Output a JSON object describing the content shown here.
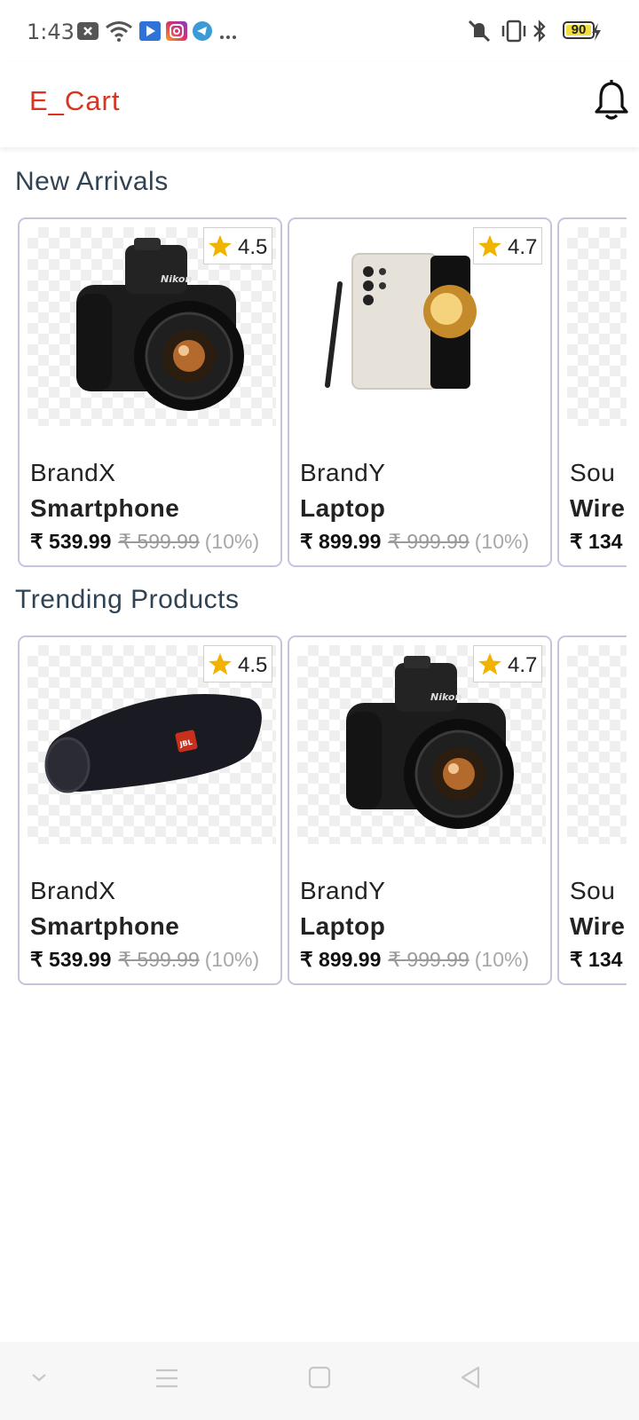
{
  "status_bar": {
    "time": "1:43",
    "battery_level": "90",
    "icons": [
      "close-box-icon",
      "wifi-icon",
      "play-store-icon",
      "instagram-icon",
      "telegram-icon",
      "more-icon",
      "silent-icon",
      "vibrate-icon",
      "bluetooth-icon",
      "battery-icon",
      "charging-icon"
    ]
  },
  "app_bar": {
    "title": "E_Cart",
    "notification_icon": "bell-icon"
  },
  "sections": [
    {
      "title": "New Arrivals",
      "products": [
        {
          "brand": "BrandX",
          "name": "Smartphone",
          "price": "₹ 539.99",
          "mrp": "₹ 599.99",
          "discount": "(10%)",
          "rating": "4.5",
          "image": "camera"
        },
        {
          "brand": "BrandY",
          "name": "Laptop",
          "price": "₹ 899.99",
          "mrp": "₹ 999.99",
          "discount": "(10%)",
          "rating": "4.7",
          "image": "phone"
        },
        {
          "brand": "Sou",
          "name": "Wire",
          "price": "₹ 134",
          "image": "blank"
        }
      ]
    },
    {
      "title": "Trending Products",
      "products": [
        {
          "brand": "BrandX",
          "name": "Smartphone",
          "price": "₹ 539.99",
          "mrp": "₹ 599.99",
          "discount": "(10%)",
          "rating": "4.5",
          "image": "speaker"
        },
        {
          "brand": "BrandY",
          "name": "Laptop",
          "price": "₹ 899.99",
          "mrp": "₹ 999.99",
          "discount": "(10%)",
          "rating": "4.7",
          "image": "camera"
        },
        {
          "brand": "Sou",
          "name": "Wire",
          "price": "₹ 134",
          "image": "blank"
        }
      ]
    }
  ],
  "nav_bar": {
    "icons": [
      "collapse-icon",
      "menu-icon",
      "home-icon",
      "back-icon"
    ]
  },
  "colors": {
    "brand": "#d9341f",
    "section_title": "#2f4355",
    "card_border": "#c6c3dd",
    "star": "#f0b400"
  }
}
